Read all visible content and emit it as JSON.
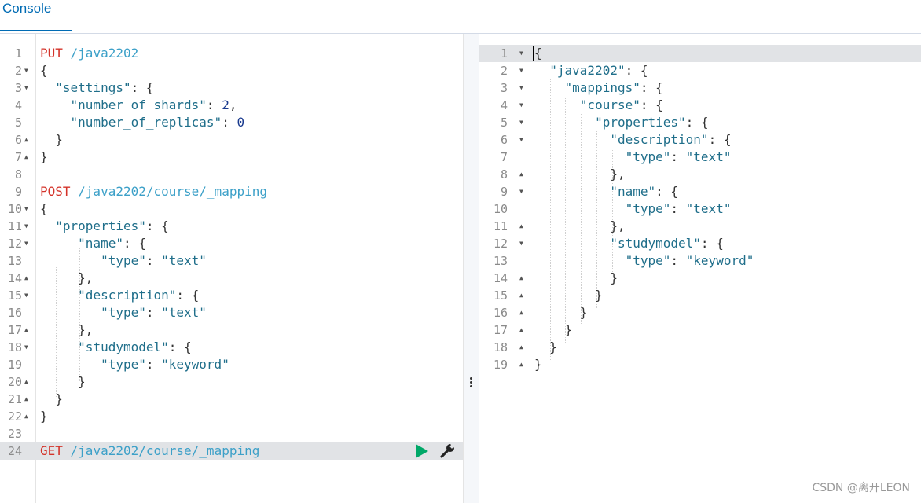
{
  "tabs": [
    {
      "label": "Console"
    }
  ],
  "request_lines": [
    {
      "n": "1",
      "fold": "",
      "parts": [
        {
          "t": "PUT",
          "c": "m"
        },
        {
          "t": " /java2202",
          "c": "u"
        }
      ]
    },
    {
      "n": "2",
      "fold": "▼",
      "parts": [
        {
          "t": "{",
          "c": "p"
        }
      ]
    },
    {
      "n": "3",
      "fold": "▼",
      "parts": [
        {
          "t": "  ",
          "c": "p"
        },
        {
          "t": "\"settings\"",
          "c": "k"
        },
        {
          "t": ": {",
          "c": "p"
        }
      ]
    },
    {
      "n": "4",
      "fold": "",
      "parts": [
        {
          "t": "    ",
          "c": "p"
        },
        {
          "t": "\"number_of_shards\"",
          "c": "k"
        },
        {
          "t": ": ",
          "c": "p"
        },
        {
          "t": "2",
          "c": "n"
        },
        {
          "t": ",",
          "c": "p"
        }
      ]
    },
    {
      "n": "5",
      "fold": "",
      "parts": [
        {
          "t": "    ",
          "c": "p"
        },
        {
          "t": "\"number_of_replicas\"",
          "c": "k"
        },
        {
          "t": ": ",
          "c": "p"
        },
        {
          "t": "0",
          "c": "n"
        }
      ]
    },
    {
      "n": "6",
      "fold": "▲",
      "parts": [
        {
          "t": "  }",
          "c": "p"
        }
      ]
    },
    {
      "n": "7",
      "fold": "▲",
      "parts": [
        {
          "t": "}",
          "c": "p"
        }
      ]
    },
    {
      "n": "8",
      "fold": "",
      "parts": []
    },
    {
      "n": "9",
      "fold": "",
      "parts": [
        {
          "t": "POST",
          "c": "m"
        },
        {
          "t": " /java2202/course/_mapping",
          "c": "u"
        }
      ]
    },
    {
      "n": "10",
      "fold": "▼",
      "parts": [
        {
          "t": "{",
          "c": "p"
        }
      ]
    },
    {
      "n": "11",
      "fold": "▼",
      "parts": [
        {
          "t": "  ",
          "c": "p"
        },
        {
          "t": "\"properties\"",
          "c": "k"
        },
        {
          "t": ": {",
          "c": "p"
        }
      ]
    },
    {
      "n": "12",
      "fold": "▼",
      "parts": [
        {
          "t": "     ",
          "c": "p"
        },
        {
          "t": "\"name\"",
          "c": "k"
        },
        {
          "t": ": {",
          "c": "p"
        }
      ]
    },
    {
      "n": "13",
      "fold": "",
      "parts": [
        {
          "t": "        ",
          "c": "p"
        },
        {
          "t": "\"type\"",
          "c": "k"
        },
        {
          "t": ": ",
          "c": "p"
        },
        {
          "t": "\"text\"",
          "c": "s"
        }
      ]
    },
    {
      "n": "14",
      "fold": "▲",
      "parts": [
        {
          "t": "     },",
          "c": "p"
        }
      ]
    },
    {
      "n": "15",
      "fold": "▼",
      "parts": [
        {
          "t": "     ",
          "c": "p"
        },
        {
          "t": "\"description\"",
          "c": "k"
        },
        {
          "t": ": {",
          "c": "p"
        }
      ]
    },
    {
      "n": "16",
      "fold": "",
      "parts": [
        {
          "t": "        ",
          "c": "p"
        },
        {
          "t": "\"type\"",
          "c": "k"
        },
        {
          "t": ": ",
          "c": "p"
        },
        {
          "t": "\"text\"",
          "c": "s"
        }
      ]
    },
    {
      "n": "17",
      "fold": "▲",
      "parts": [
        {
          "t": "     },",
          "c": "p"
        }
      ]
    },
    {
      "n": "18",
      "fold": "▼",
      "parts": [
        {
          "t": "     ",
          "c": "p"
        },
        {
          "t": "\"studymodel\"",
          "c": "k"
        },
        {
          "t": ": {",
          "c": "p"
        }
      ]
    },
    {
      "n": "19",
      "fold": "",
      "parts": [
        {
          "t": "        ",
          "c": "p"
        },
        {
          "t": "\"type\"",
          "c": "k"
        },
        {
          "t": ": ",
          "c": "p"
        },
        {
          "t": "\"keyword\"",
          "c": "s"
        }
      ]
    },
    {
      "n": "20",
      "fold": "▲",
      "parts": [
        {
          "t": "     }",
          "c": "p"
        }
      ]
    },
    {
      "n": "21",
      "fold": "▲",
      "parts": [
        {
          "t": "  }",
          "c": "p"
        }
      ]
    },
    {
      "n": "22",
      "fold": "▲",
      "parts": [
        {
          "t": "}",
          "c": "p"
        }
      ]
    },
    {
      "n": "23",
      "fold": "",
      "parts": []
    },
    {
      "n": "24",
      "fold": "",
      "active": true,
      "parts": [
        {
          "t": "GET",
          "c": "m"
        },
        {
          "t": " /java2202/course/_mapping",
          "c": "u"
        }
      ]
    }
  ],
  "response_lines": [
    {
      "n": "1",
      "fold": "▼",
      "active": true,
      "parts": [
        {
          "t": "{",
          "c": "p"
        }
      ]
    },
    {
      "n": "2",
      "fold": "▼",
      "parts": [
        {
          "t": "  ",
          "c": "p"
        },
        {
          "t": "\"java2202\"",
          "c": "k"
        },
        {
          "t": ": {",
          "c": "p"
        }
      ]
    },
    {
      "n": "3",
      "fold": "▼",
      "parts": [
        {
          "t": "    ",
          "c": "p"
        },
        {
          "t": "\"mappings\"",
          "c": "k"
        },
        {
          "t": ": {",
          "c": "p"
        }
      ]
    },
    {
      "n": "4",
      "fold": "▼",
      "parts": [
        {
          "t": "      ",
          "c": "p"
        },
        {
          "t": "\"course\"",
          "c": "k"
        },
        {
          "t": ": {",
          "c": "p"
        }
      ]
    },
    {
      "n": "5",
      "fold": "▼",
      "parts": [
        {
          "t": "        ",
          "c": "p"
        },
        {
          "t": "\"properties\"",
          "c": "k"
        },
        {
          "t": ": {",
          "c": "p"
        }
      ]
    },
    {
      "n": "6",
      "fold": "▼",
      "parts": [
        {
          "t": "          ",
          "c": "p"
        },
        {
          "t": "\"description\"",
          "c": "k"
        },
        {
          "t": ": {",
          "c": "p"
        }
      ]
    },
    {
      "n": "7",
      "fold": "",
      "parts": [
        {
          "t": "            ",
          "c": "p"
        },
        {
          "t": "\"type\"",
          "c": "k"
        },
        {
          "t": ": ",
          "c": "p"
        },
        {
          "t": "\"text\"",
          "c": "s"
        }
      ]
    },
    {
      "n": "8",
      "fold": "▲",
      "parts": [
        {
          "t": "          },",
          "c": "p"
        }
      ]
    },
    {
      "n": "9",
      "fold": "▼",
      "parts": [
        {
          "t": "          ",
          "c": "p"
        },
        {
          "t": "\"name\"",
          "c": "k"
        },
        {
          "t": ": {",
          "c": "p"
        }
      ]
    },
    {
      "n": "10",
      "fold": "",
      "parts": [
        {
          "t": "            ",
          "c": "p"
        },
        {
          "t": "\"type\"",
          "c": "k"
        },
        {
          "t": ": ",
          "c": "p"
        },
        {
          "t": "\"text\"",
          "c": "s"
        }
      ]
    },
    {
      "n": "11",
      "fold": "▲",
      "parts": [
        {
          "t": "          },",
          "c": "p"
        }
      ]
    },
    {
      "n": "12",
      "fold": "▼",
      "parts": [
        {
          "t": "          ",
          "c": "p"
        },
        {
          "t": "\"studymodel\"",
          "c": "k"
        },
        {
          "t": ": {",
          "c": "p"
        }
      ]
    },
    {
      "n": "13",
      "fold": "",
      "parts": [
        {
          "t": "            ",
          "c": "p"
        },
        {
          "t": "\"type\"",
          "c": "k"
        },
        {
          "t": ": ",
          "c": "p"
        },
        {
          "t": "\"keyword\"",
          "c": "s"
        }
      ]
    },
    {
      "n": "14",
      "fold": "▲",
      "parts": [
        {
          "t": "          }",
          "c": "p"
        }
      ]
    },
    {
      "n": "15",
      "fold": "▲",
      "parts": [
        {
          "t": "        }",
          "c": "p"
        }
      ]
    },
    {
      "n": "16",
      "fold": "▲",
      "parts": [
        {
          "t": "      }",
          "c": "p"
        }
      ]
    },
    {
      "n": "17",
      "fold": "▲",
      "parts": [
        {
          "t": "    }",
          "c": "p"
        }
      ]
    },
    {
      "n": "18",
      "fold": "▲",
      "parts": [
        {
          "t": "  }",
          "c": "p"
        }
      ]
    },
    {
      "n": "19",
      "fold": "▲",
      "parts": [
        {
          "t": "}",
          "c": "p"
        }
      ]
    }
  ],
  "watermark": "CSDN @离开LEON",
  "colors": {
    "method": "#d4332a",
    "url": "#3ca0c8",
    "key": "#1f6e8a",
    "number": "#1a3b8f",
    "run": "#00a868",
    "tab_accent": "#006bb4"
  },
  "icons": {
    "run": "play-icon",
    "settings": "wrench-icon",
    "resize": "vertical-dots-icon"
  }
}
